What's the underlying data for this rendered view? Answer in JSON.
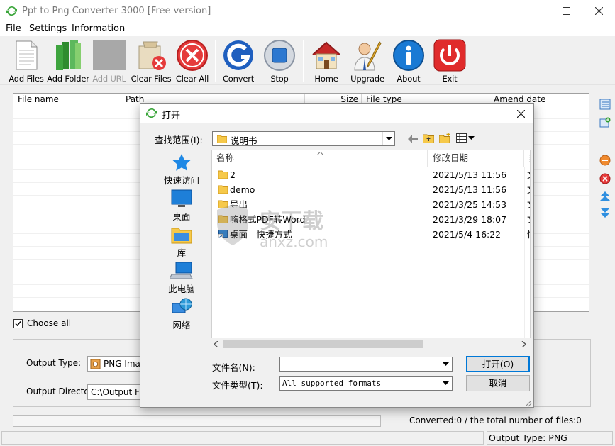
{
  "window": {
    "title": "Ppt to Png Converter 3000 [Free version]"
  },
  "menu": [
    "File",
    "Settings",
    "Information"
  ],
  "toolbar": [
    {
      "label": "Add Files",
      "icon": "document-icon",
      "enabled": true
    },
    {
      "label": "Add Folder",
      "icon": "green-folder-icon",
      "enabled": true
    },
    {
      "label": "Add URL",
      "icon": "url-icon",
      "enabled": false
    },
    {
      "label": "Clear Files",
      "icon": "clear-files-icon",
      "enabled": true
    },
    {
      "label": "Clear All",
      "icon": "clear-all-icon",
      "enabled": true
    },
    {
      "label": "Convert",
      "icon": "convert-icon",
      "enabled": true
    },
    {
      "label": "Stop",
      "icon": "stop-icon",
      "enabled": true
    },
    {
      "label": "Home",
      "icon": "home-icon",
      "enabled": true
    },
    {
      "label": "Upgrade",
      "icon": "upgrade-icon",
      "enabled": true
    },
    {
      "label": "About",
      "icon": "about-icon",
      "enabled": true
    },
    {
      "label": "Exit",
      "icon": "exit-icon",
      "enabled": true
    }
  ],
  "file_list": {
    "columns": [
      "File name",
      "Path",
      "Size",
      "File type",
      "Amend date"
    ]
  },
  "choose_all": {
    "label": "Choose all",
    "checked": true
  },
  "output": {
    "type_label": "Output Type:",
    "type_value": "PNG Image",
    "dir_label": "Output Directory:",
    "dir_value": "C:\\Output Files"
  },
  "status": {
    "converted": "Converted:0  /  the total number of files:0",
    "output_type": "Output Type: PNG"
  },
  "dialog": {
    "title": "打开",
    "look_in_label": "查找范围(I):",
    "look_in_value": "说明书",
    "places": [
      "快速访问",
      "桌面",
      "库",
      "此电脑",
      "网络"
    ],
    "columns": {
      "name": "名称",
      "date": "修改日期",
      "type": "类"
    },
    "files": [
      {
        "name": "2",
        "date": "2021/5/13 11:56",
        "type": "文",
        "kind": "folder"
      },
      {
        "name": "demo",
        "date": "2021/5/13 11:56",
        "type": "文",
        "kind": "folder"
      },
      {
        "name": "导出",
        "date": "2021/3/25 14:53",
        "type": "文",
        "kind": "folder"
      },
      {
        "name": "嗨格式PDF转Word",
        "date": "2021/3/29 18:07",
        "type": "文",
        "kind": "folder"
      },
      {
        "name": "桌面 - 快捷方式",
        "date": "2021/5/4 16:22",
        "type": "快",
        "kind": "shortcut"
      }
    ],
    "filename_label": "文件名(N):",
    "filename_value": "",
    "filetype_label": "文件类型(T):",
    "filetype_value": "All supported formats",
    "open_button": "打开(O)",
    "cancel_button": "取消"
  },
  "watermark": {
    "text": "安下载",
    "url": "anxz.com"
  },
  "colors": {
    "accent": "#0078d7",
    "folder": "#f6c94a"
  }
}
